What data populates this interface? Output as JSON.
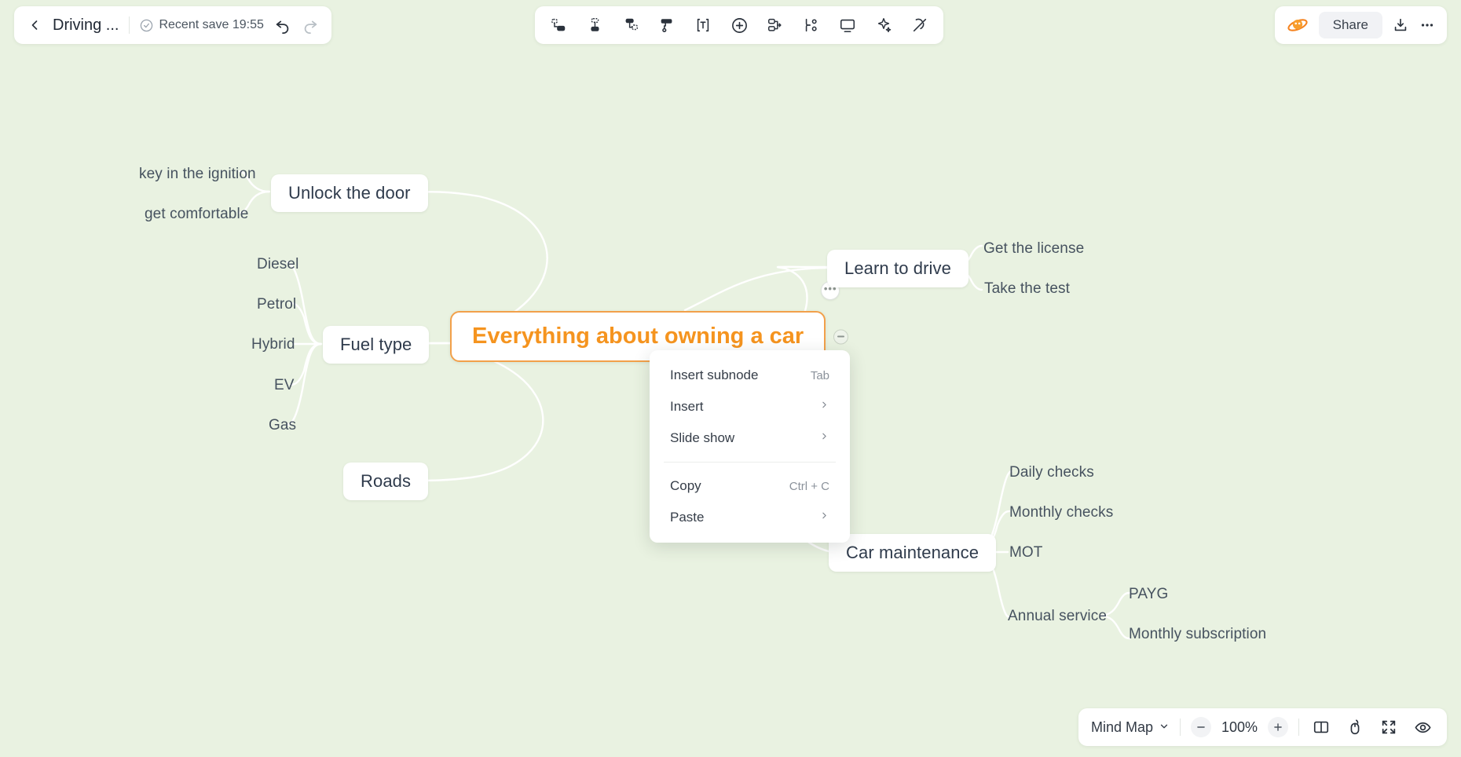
{
  "app": {
    "background_color": "#e9f2e1",
    "accent_color": "#f5941f"
  },
  "topbar_left": {
    "back_icon": "chevron-left-icon",
    "doc_title": "Driving ...",
    "save_icon": "check-circle-icon",
    "save_status": "Recent save 19:55",
    "undo_icon": "undo-icon",
    "redo_icon": "redo-icon"
  },
  "toolbar_center": {
    "tools": [
      {
        "name": "insert-subnode-icon",
        "label": "Insert subnode"
      },
      {
        "name": "insert-sibling-icon",
        "label": "Insert sibling"
      },
      {
        "name": "insert-child-icon",
        "label": "Insert child"
      },
      {
        "name": "format-painter-icon",
        "label": "Format painter"
      },
      {
        "name": "text-box-icon",
        "label": "Text"
      },
      {
        "name": "add-circle-icon",
        "label": "Add"
      },
      {
        "name": "relationship-icon",
        "label": "Relationship"
      },
      {
        "name": "summary-icon",
        "label": "Summary"
      },
      {
        "name": "frame-icon",
        "label": "Frame"
      },
      {
        "name": "ai-sparkle-icon",
        "label": "AI"
      },
      {
        "name": "eraser-icon",
        "label": "Clear style"
      }
    ]
  },
  "topbar_right": {
    "logo_icon": "ai-planet-logo",
    "share_label": "Share",
    "export_icon": "download-icon",
    "more_icon": "more-horizontal-icon"
  },
  "bottombar": {
    "mode_label": "Mind Map",
    "mode_chevron": "chevron-down-icon",
    "zoom_out_icon": "minus-icon",
    "zoom_level": "100%",
    "zoom_in_icon": "plus-icon",
    "split_view_icon": "split-panel-icon",
    "mouse_mode_icon": "mouse-pointer-icon",
    "fit_screen_icon": "fullscreen-icon",
    "preview_icon": "eye-icon"
  },
  "context_menu": {
    "items": [
      {
        "label": "Insert subnode",
        "shortcut": "Tab",
        "submenu": false
      },
      {
        "label": "Insert",
        "shortcut": "",
        "submenu": true
      },
      {
        "label": "Slide show",
        "shortcut": "",
        "submenu": true
      },
      {
        "label": "Copy",
        "shortcut": "Ctrl + C",
        "submenu": false
      },
      {
        "label": "Paste",
        "shortcut": "",
        "submenu": true
      }
    ],
    "separator_after_index": 2
  },
  "mindmap": {
    "root": {
      "label": "Everything about owning a car",
      "selected": true,
      "menu_handle_icon": "node-menu-icon",
      "collapse_handle_icon": "collapse-icon"
    },
    "branches": [
      {
        "label": "Unlock the door",
        "children": [
          {
            "label": "key in the ignition"
          },
          {
            "label": "get comfortable"
          }
        ]
      },
      {
        "label": "Fuel type",
        "children": [
          {
            "label": "Diesel"
          },
          {
            "label": "Petrol"
          },
          {
            "label": "Hybrid"
          },
          {
            "label": "EV"
          },
          {
            "label": "Gas"
          }
        ]
      },
      {
        "label": "Roads",
        "children": []
      },
      {
        "label": "Learn to drive",
        "children": [
          {
            "label": "Get the license"
          },
          {
            "label": "Take the test"
          }
        ]
      },
      {
        "label": "Car maintenance",
        "children": [
          {
            "label": "Daily checks"
          },
          {
            "label": "Monthly checks"
          },
          {
            "label": "MOT"
          },
          {
            "label": "Annual service",
            "children": [
              {
                "label": "PAYG"
              },
              {
                "label": "Monthly subscription"
              }
            ]
          }
        ]
      }
    ]
  }
}
